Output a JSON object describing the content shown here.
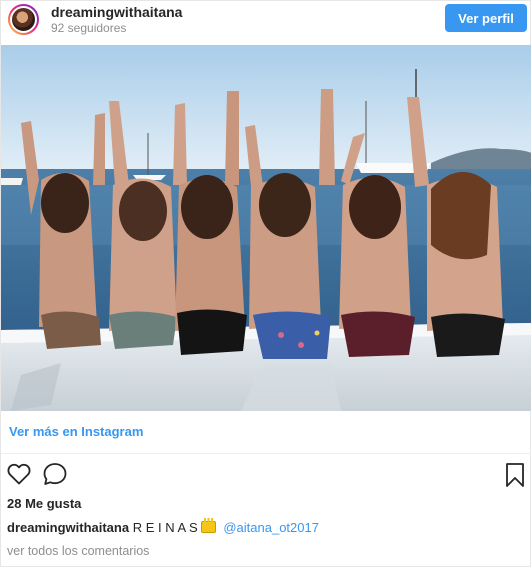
{
  "header": {
    "username": "dreamingwithaitana",
    "followers": "92 seguidores",
    "view_profile_label": "Ver perfil"
  },
  "post": {
    "view_more_label": "Ver más en Instagram",
    "likes": "28 Me gusta",
    "caption": {
      "username": "dreamingwithaitana",
      "text": "R E I N A S",
      "emoji": "crown-emoji",
      "mention": "@aitana_ot2017"
    },
    "view_all_comments": "ver todos los comentarios"
  },
  "icons": {
    "like": "heart-icon",
    "comment": "comment-icon",
    "save": "bookmark-icon"
  },
  "colors": {
    "accent": "#3897f0",
    "text": "#262626",
    "muted": "#8e8e8e"
  }
}
